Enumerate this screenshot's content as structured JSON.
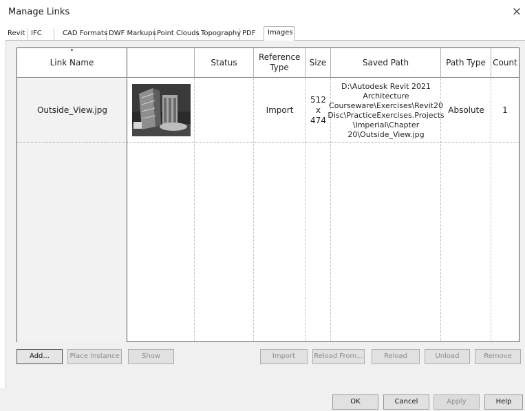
{
  "window": {
    "title": "Manage Links",
    "close_symbol": "×"
  },
  "tabs": [
    {
      "label": "Revit",
      "active": false
    },
    {
      "label": "IFC",
      "active": false
    },
    {
      "label": "CAD Formats",
      "active": false
    },
    {
      "label": "DWF Markups",
      "active": false
    },
    {
      "label": "Point Clouds",
      "active": false
    },
    {
      "label": "Topography",
      "active": false
    },
    {
      "label": "PDF",
      "active": false
    },
    {
      "label": "Images",
      "active": true
    }
  ],
  "table": {
    "sort_indicator": "▾",
    "columns": [
      "Link Name",
      "",
      "Status",
      "Reference Type",
      "Size",
      "Saved Path",
      "Path Type",
      "Count"
    ],
    "rows": [
      {
        "link_name": "Outside_View.jpg",
        "preview_icon": "building-thumbnail",
        "status": "",
        "reference_type": "Import",
        "size": "512 x 474",
        "saved_path": "D:\\Autodesk Revit 2021 Architecture Courseware\\Exercises\\Revit20 Disc\\PracticeExercises.Projects \\Imperial\\Chapter 20\\Outside_View.jpg",
        "path_type": "Absolute",
        "count": "1"
      }
    ]
  },
  "buttons": {
    "add": "Add...",
    "place_instance": "Place Instance",
    "show": "Show",
    "import": "Import",
    "reload_from": "Reload From...",
    "reload": "Reload",
    "unload": "Unload",
    "remove": "Remove",
    "ok": "OK",
    "cancel": "Cancel",
    "apply": "Apply",
    "help": "Help"
  },
  "colors": {
    "panel_bg": "#f0f0f0",
    "grid_border": "#555555",
    "disabled_text": "#8c8c8c"
  }
}
